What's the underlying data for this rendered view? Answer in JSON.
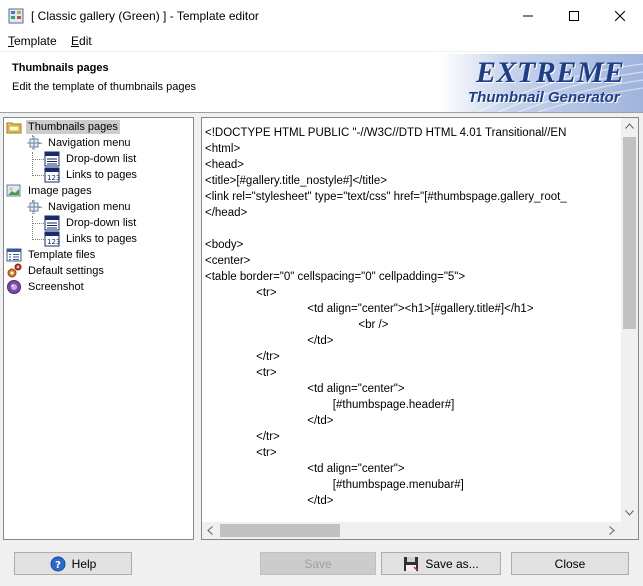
{
  "window": {
    "title": "[ Classic gallery (Green) ] - Template editor"
  },
  "menu": [
    {
      "label": "Template",
      "accel": "T",
      "rest": "emplate"
    },
    {
      "label": "Edit",
      "accel": "E",
      "rest": "dit"
    }
  ],
  "header": {
    "title": "Thumbnails pages",
    "subtitle": "Edit the template of thumbnails pages",
    "logo_line1": "EXTREME",
    "logo_line2": "Thumbnail Generator"
  },
  "tree": {
    "items": [
      {
        "label": "Thumbnails pages",
        "icon": "folder-icon",
        "selected": true
      },
      {
        "label": "Navigation menu",
        "icon": "navigation-icon"
      },
      {
        "label": "Drop-down list",
        "icon": "dropdown-list-icon"
      },
      {
        "label": "Links to pages",
        "icon": "page-links-icon"
      },
      {
        "label": "Image pages",
        "icon": "image-pages-icon"
      },
      {
        "label": "Navigation menu",
        "icon": "navigation-icon"
      },
      {
        "label": "Drop-down list",
        "icon": "dropdown-list-icon"
      },
      {
        "label": "Links to pages",
        "icon": "page-links-icon"
      },
      {
        "label": "Template files",
        "icon": "template-files-icon"
      },
      {
        "label": "Default settings",
        "icon": "settings-icon"
      },
      {
        "label": "Screenshot",
        "icon": "screenshot-icon"
      }
    ]
  },
  "editor": {
    "lines": [
      "<!DOCTYPE HTML PUBLIC \"-//W3C//DTD HTML 4.01 Transitional//EN",
      "<html>",
      "<head>",
      "<title>[#gallery.title_nostyle#]</title>",
      "<link rel=\"stylesheet\" type=\"text/css\" href=\"[#thumbspage.gallery_root_",
      "</head>",
      "",
      "<body>",
      "<center>",
      "<table border=\"0\" cellspacing=\"0\" cellpadding=\"5\">",
      "                <tr>",
      "                                <td align=\"center\"><h1>[#gallery.title#]</h1>",
      "                                                <br />",
      "                                </td>",
      "                </tr>",
      "                <tr>",
      "                                <td align=\"center\">",
      "                                        [#thumbspage.header#]",
      "                                </td>",
      "                </tr>",
      "                <tr>",
      "                                <td align=\"center\">",
      "                                        [#thumbspage.menubar#]",
      "                                </td>"
    ]
  },
  "buttons": {
    "help": "Help",
    "save": "Save",
    "save_as": "Save as...",
    "close": "Close"
  }
}
